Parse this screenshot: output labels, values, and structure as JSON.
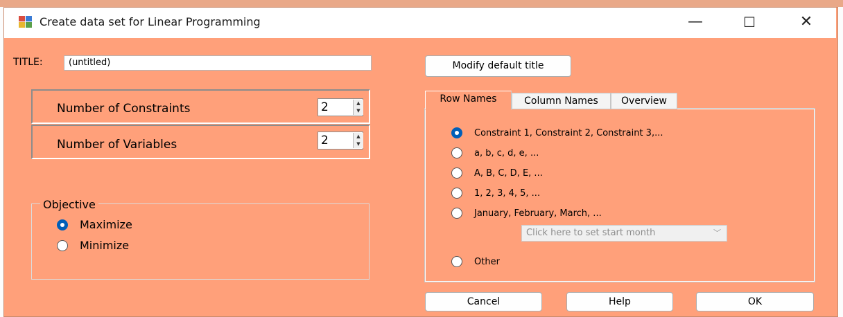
{
  "window": {
    "title": "Create data set for Linear Programming",
    "minimize_glyph": "—",
    "maximize_glyph": "☐",
    "close_glyph": "✕"
  },
  "title_field": {
    "label": "TITLE:",
    "value": "(untitled)"
  },
  "modify_button": "Modify default title",
  "constraints": {
    "label": "Number of Constraints",
    "value": "2"
  },
  "variables": {
    "label": "Number of Variables",
    "value": "2"
  },
  "objective": {
    "legend": "Objective",
    "options": [
      "Maximize",
      "Minimize"
    ],
    "selected": "Maximize"
  },
  "tabs": [
    "Row Names",
    "Column Names",
    "Overview"
  ],
  "active_tab": "Row Names",
  "row_names": {
    "options": [
      "Constraint 1, Constraint 2, Constraint 3,...",
      "a, b, c, d, e, ...",
      "A, B, C, D, E, ...",
      "1, 2, 3, 4, 5, ...",
      "January, February, March, ...",
      "Other"
    ],
    "selected": "Constraint 1, Constraint 2, Constraint 3,...",
    "month_combo_placeholder": "Click here to set start month"
  },
  "buttons": {
    "cancel": "Cancel",
    "help": "Help",
    "ok": "OK"
  },
  "colors": {
    "dialog_bg": "#ffa07a",
    "accent": "#005fb8"
  }
}
